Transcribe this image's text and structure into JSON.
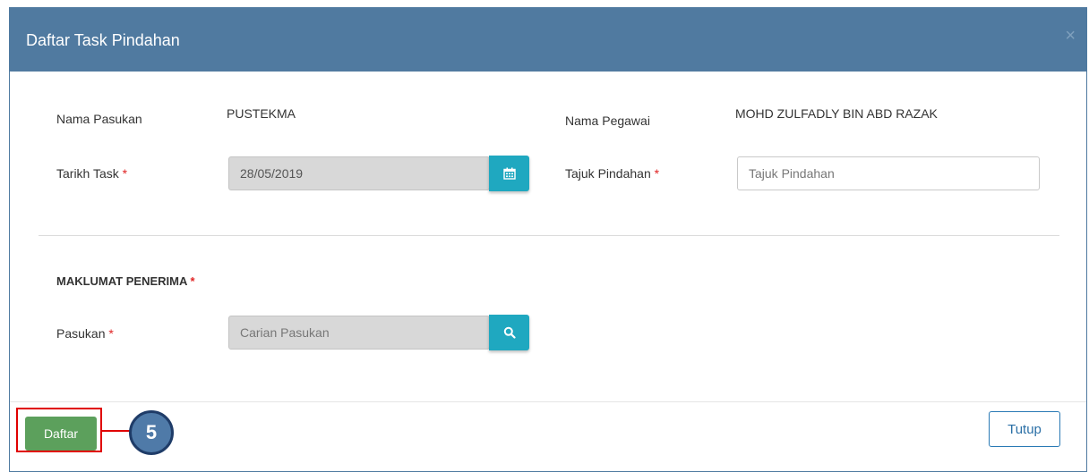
{
  "modal": {
    "title": "Daftar Task Pindahan",
    "close_symbol": "×"
  },
  "form": {
    "nama_pasukan_label": "Nama Pasukan",
    "nama_pasukan_value": "PUSTEKMA",
    "nama_pegawai_label": "Nama Pegawai",
    "nama_pegawai_value": "MOHD ZULFADLY BIN ABD RAZAK",
    "tarikh_task_label": "Tarikh Task",
    "tarikh_task_value": "28/05/2019",
    "tajuk_pindahan_label": "Tajuk Pindahan",
    "tajuk_pindahan_placeholder": "Tajuk Pindahan",
    "required_mark": "*",
    "section_title": "MAKLUMAT PENERIMA",
    "pasukan_label": "Pasukan",
    "pasukan_placeholder": "Carian Pasukan"
  },
  "footer": {
    "daftar_label": "Daftar",
    "tutup_label": "Tutup",
    "step_number": "5"
  },
  "icons": {
    "calendar": "calendar-icon",
    "search": "search-icon"
  },
  "colors": {
    "header": "#507aa0",
    "addon": "#1fa8c0",
    "daftar": "#5ca05c",
    "highlight": "#e00000",
    "badge": "#4f7aa8"
  }
}
